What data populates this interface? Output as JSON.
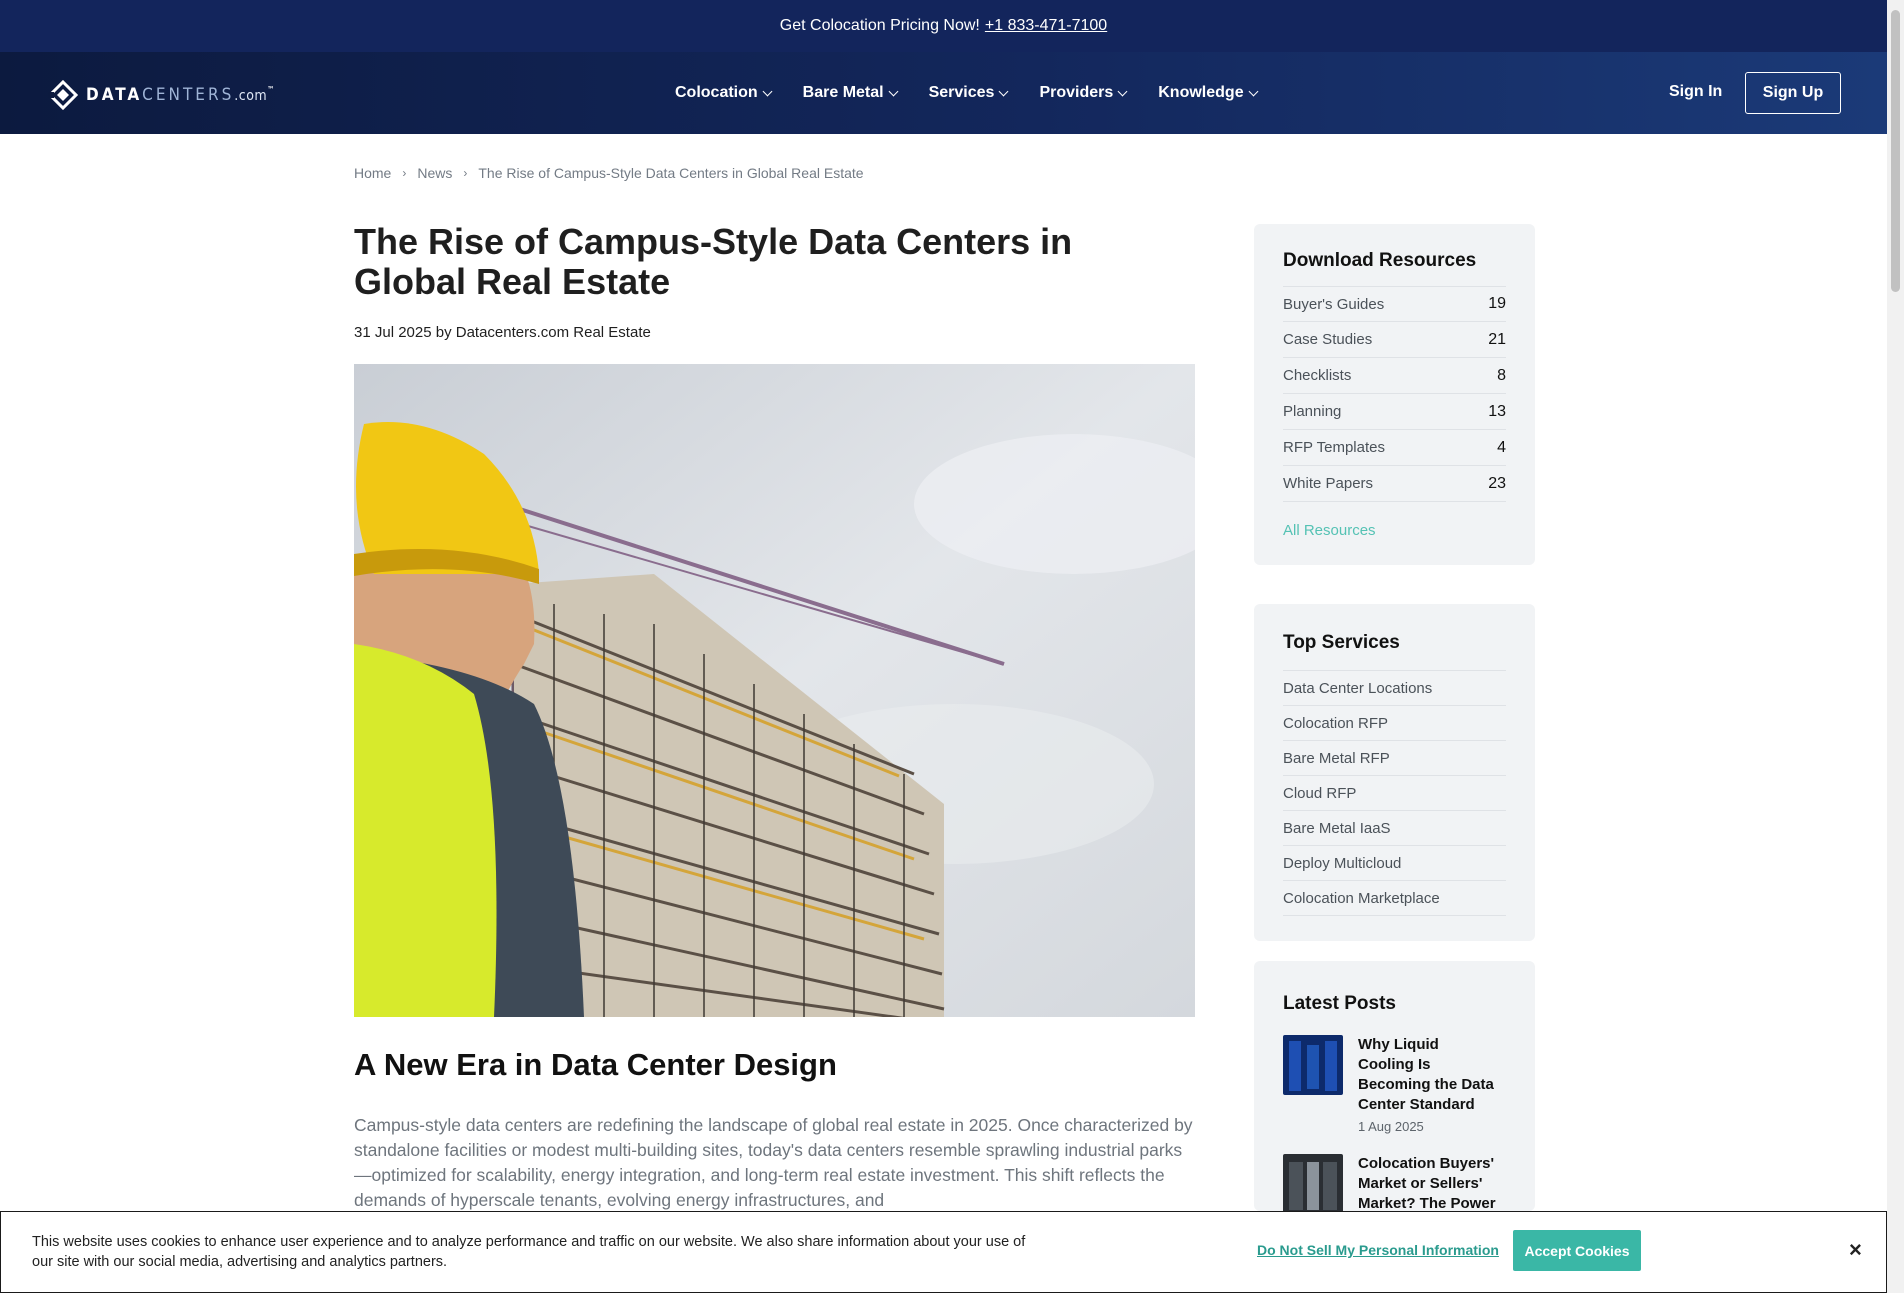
{
  "promo": {
    "text": "Get Colocation Pricing Now!",
    "phone": "+1 833-471-7100"
  },
  "logo": {
    "brand_bold": "DATA",
    "brand_light": "CENTERS",
    "suffix": ".com",
    "tm": "™"
  },
  "nav": {
    "items": [
      {
        "label": "Colocation"
      },
      {
        "label": "Bare Metal"
      },
      {
        "label": "Services"
      },
      {
        "label": "Providers"
      },
      {
        "label": "Knowledge"
      }
    ],
    "sign_in": "Sign In",
    "sign_up": "Sign Up"
  },
  "breadcrumb": {
    "home": "Home",
    "news": "News",
    "current": "The Rise of Campus-Style Data Centers in Global Real Estate",
    "separator": "›"
  },
  "article": {
    "title": "The Rise of Campus-Style Data Centers in Global Real Estate",
    "meta": "31 Jul 2025 by Datacenters.com Real Estate",
    "h2": "A New Era in Data Center Design",
    "paragraph": "Campus-style data centers are redefining the landscape of global real estate in 2025. Once characterized by standalone facilities or modest multi-building sites, today's data centers resemble sprawling industrial parks—optimized for scalability, energy integration, and long-term real estate investment. This shift reflects the demands of hyperscale tenants, evolving energy infrastructures, and"
  },
  "download_resources": {
    "title": "Download Resources",
    "items": [
      {
        "label": "Buyer's Guides",
        "count": "19"
      },
      {
        "label": "Case Studies",
        "count": "21"
      },
      {
        "label": "Checklists",
        "count": "8"
      },
      {
        "label": "Planning",
        "count": "13"
      },
      {
        "label": "RFP Templates",
        "count": "4"
      },
      {
        "label": "White Papers",
        "count": "23"
      }
    ],
    "all_link": "All Resources"
  },
  "top_services": {
    "title": "Top Services",
    "items": [
      "Data Center Locations",
      "Colocation RFP",
      "Bare Metal RFP",
      "Cloud RFP",
      "Bare Metal IaaS",
      "Deploy Multicloud",
      "Colocation Marketplace"
    ]
  },
  "latest_posts": {
    "title": "Latest Posts",
    "posts": [
      {
        "title": "Why Liquid Cooling Is Becoming the Data Center Standard",
        "date": "1 Aug 2025"
      },
      {
        "title": "Colocation Buyers' Market or Sellers' Market? The Power",
        "date": ""
      }
    ]
  },
  "cookie": {
    "text": "This website uses cookies to enhance user experience and to analyze performance and traffic on our website. We also share information about your use of our site with our social media, advertising and analytics partners.",
    "dns": "Do Not Sell My Personal Information",
    "accept": "Accept Cookies",
    "close": "×"
  },
  "colors": {
    "promo_bg": "#13255c",
    "nav_bg": "#0c1a3f",
    "accent_teal": "#3ab7a6",
    "sidebar_bg": "#f1f3f5"
  },
  "icons": [
    "logo-diamond-icon",
    "chevron-down-icon",
    "close-icon"
  ]
}
